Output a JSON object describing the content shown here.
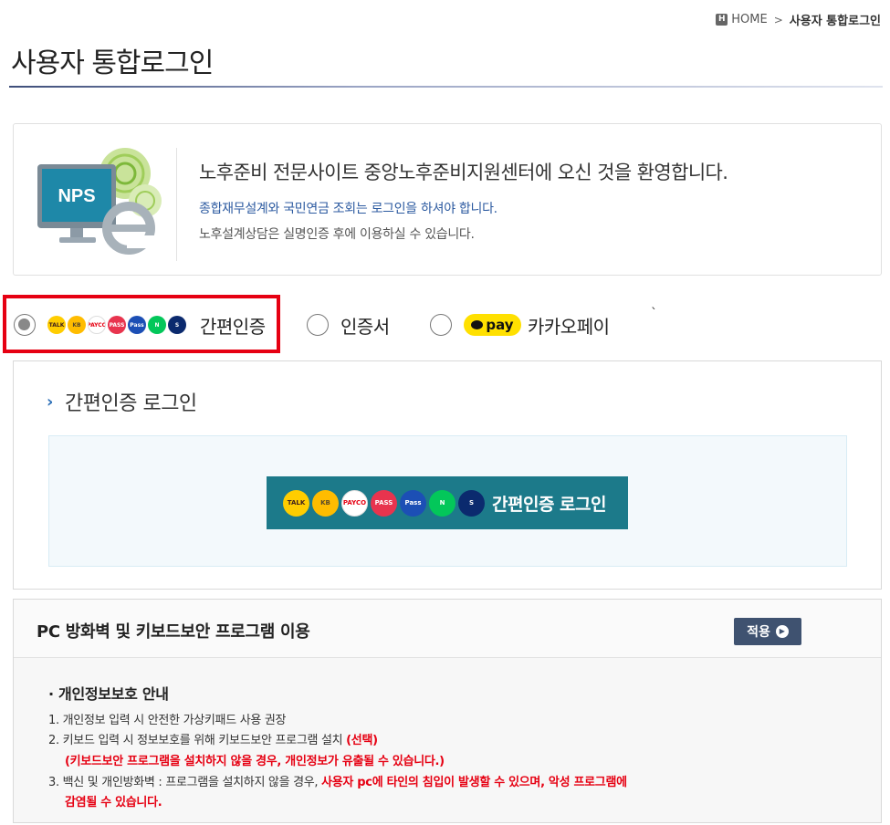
{
  "breadcrumb": {
    "home_icon_text": "H",
    "home": "HOME",
    "separator": ">",
    "current": "사용자 통합로그인"
  },
  "page": {
    "title": "사용자 통합로그인"
  },
  "welcome": {
    "logo_text": "NPS",
    "main": "노후준비 전문사이트 중앙노후준비지원센터에 오신 것을 환영합니다.",
    "blue": "종합재무설계와 국민연금 조회는 로그인을 하셔야 합니다.",
    "gray": "노후설계상담은 실명인증 후에 이용하실 수 있습니다."
  },
  "methods": {
    "simple_auth": {
      "label": "간편인증",
      "selected": true
    },
    "certificate": {
      "label": "인증서",
      "selected": false
    },
    "kakaopay": {
      "label": "카카오페이",
      "badge": "pay",
      "selected": false
    },
    "tick": "`"
  },
  "provider_icons": [
    {
      "name": "kakaotalk-icon",
      "text": "TALK",
      "bg": "#ffcd00",
      "fg": "#3c1e1e"
    },
    {
      "name": "kb-icon",
      "text": "KB",
      "bg": "#ffbc00",
      "fg": "#5a4a2a"
    },
    {
      "name": "payco-icon",
      "text": "PAYCO",
      "bg": "#ffffff",
      "fg": "#e60012"
    },
    {
      "name": "pass-icon",
      "text": "PASS",
      "bg": "#e8344e",
      "fg": "#ffffff"
    },
    {
      "name": "samsung-pass-icon",
      "text": "Pass",
      "bg": "#1c4fb5",
      "fg": "#ffffff"
    },
    {
      "name": "naver-icon",
      "text": "N",
      "bg": "#03c75a",
      "fg": "#ffffff"
    },
    {
      "name": "shinhan-icon",
      "text": "S",
      "bg": "#0b2a6e",
      "fg": "#ffffff"
    }
  ],
  "login_panel": {
    "heading": "간편인증 로그인",
    "button_label": "간편인증 로그인"
  },
  "security": {
    "title": "PC 방화벽 및 키보드보안 프로그램 이용",
    "apply_label": "적용",
    "privacy_heading": "· 개인정보보호 안내",
    "line1": "1. 개인정보 입력 시 안전한 가상키패드 사용 권장",
    "line2_prefix": "2. 키보드 입력 시 정보보호를 위해 키보드보안 프로그램 설치 ",
    "line2_red": "(선택)",
    "line3_red": "(키보드보안 프로그램을 설치하지 않을 경우, 개인정보가 유출될 수 있습니다.)",
    "line4_prefix": "3. 백신 및 개인방화벽 : 프로그램을 설치하지 않을 경우, ",
    "line4_red": "사용자 pc에 타인의 침입이 발생할 수 있으며, 악성 프로그램에",
    "line5_red": "감염될 수 있습니다."
  }
}
